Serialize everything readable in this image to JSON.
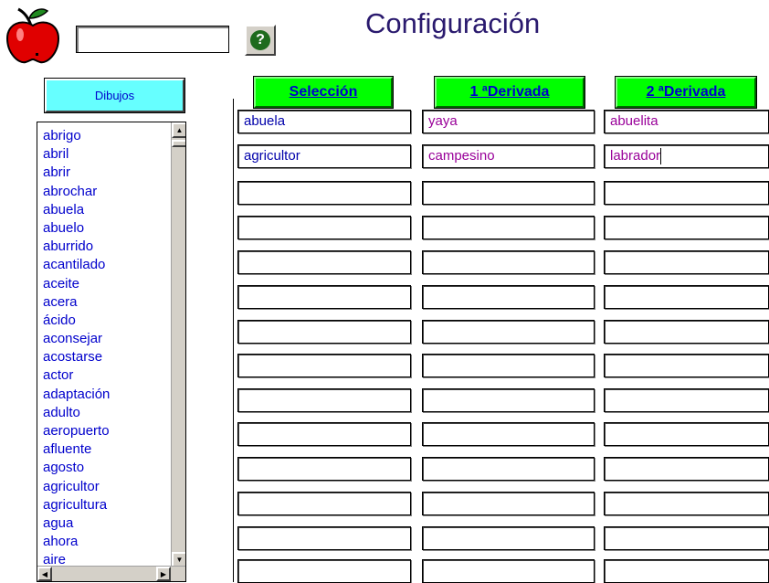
{
  "header": {
    "title": "Configuración",
    "search_value": "",
    "help_icon_glyph": "?"
  },
  "sidebar": {
    "dibujos_label": "Dibujos",
    "words": [
      "abrigo",
      "abril",
      "abrir",
      "abrochar",
      "abuela",
      "abuelo",
      "aburrido",
      "acantilado",
      "aceite",
      "acera",
      "ácido",
      "aconsejar",
      "acostarse",
      "actor",
      "adaptación",
      "adulto",
      "aeropuerto",
      "afluente",
      "agosto",
      "agricultor",
      "agricultura",
      "agua",
      "ahora",
      "aire"
    ]
  },
  "columns": {
    "seleccion": "Selección",
    "derivada1": "1 ªDerivada",
    "derivada2": "2 ªDerivada"
  },
  "rows": [
    {
      "c1": "abuela",
      "c2": "yaya",
      "c3": "abuelita"
    },
    {
      "c1": "agricultor",
      "c2": "campesino",
      "c3": "labrador"
    },
    {
      "c1": "",
      "c2": "",
      "c3": ""
    },
    {
      "c1": "",
      "c2": "",
      "c3": ""
    },
    {
      "c1": "",
      "c2": "",
      "c3": ""
    },
    {
      "c1": "",
      "c2": "",
      "c3": ""
    },
    {
      "c1": "",
      "c2": "",
      "c3": ""
    },
    {
      "c1": "",
      "c2": "",
      "c3": ""
    },
    {
      "c1": "",
      "c2": "",
      "c3": ""
    },
    {
      "c1": "",
      "c2": "",
      "c3": ""
    },
    {
      "c1": "",
      "c2": "",
      "c3": ""
    },
    {
      "c1": "",
      "c2": "",
      "c3": ""
    },
    {
      "c1": "",
      "c2": "",
      "c3": ""
    },
    {
      "c1": "",
      "c2": "",
      "c3": ""
    }
  ],
  "colors": {
    "header_green": "#00ff00",
    "dibujos_cyan": "#66ffff",
    "link_blue": "#0000cc",
    "derivada_purple": "#990099",
    "title_color": "#2a1a6e"
  }
}
